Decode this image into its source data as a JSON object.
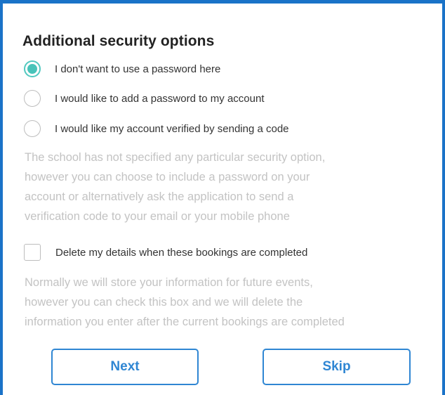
{
  "panel": {
    "title": "Additional security options"
  },
  "options": [
    {
      "label": "I don't want to use a password here",
      "selected": true
    },
    {
      "label": "I would like to add a password to my account",
      "selected": false
    },
    {
      "label": "I would like my account verified by sending a code",
      "selected": false
    }
  ],
  "security_help": [
    "The school has not specified any particular security option,",
    "however you can choose to include a password on your",
    "account or alternatively ask the application to send a",
    "verification code to your email or your mobile phone"
  ],
  "delete_details": {
    "label": "Delete my details when these bookings are completed",
    "checked": false
  },
  "delete_help": [
    "Normally we will store your information for future events,",
    "however you can check this box and we will delete the",
    "information you enter after the current bookings are completed"
  ],
  "buttons": {
    "next_label": "Next",
    "skip_label": "Skip"
  },
  "colors": {
    "frame_border": "#1a73c8",
    "accent": "#48c3b9",
    "button": "#2f86d3",
    "muted_text": "#c3c3c3"
  }
}
